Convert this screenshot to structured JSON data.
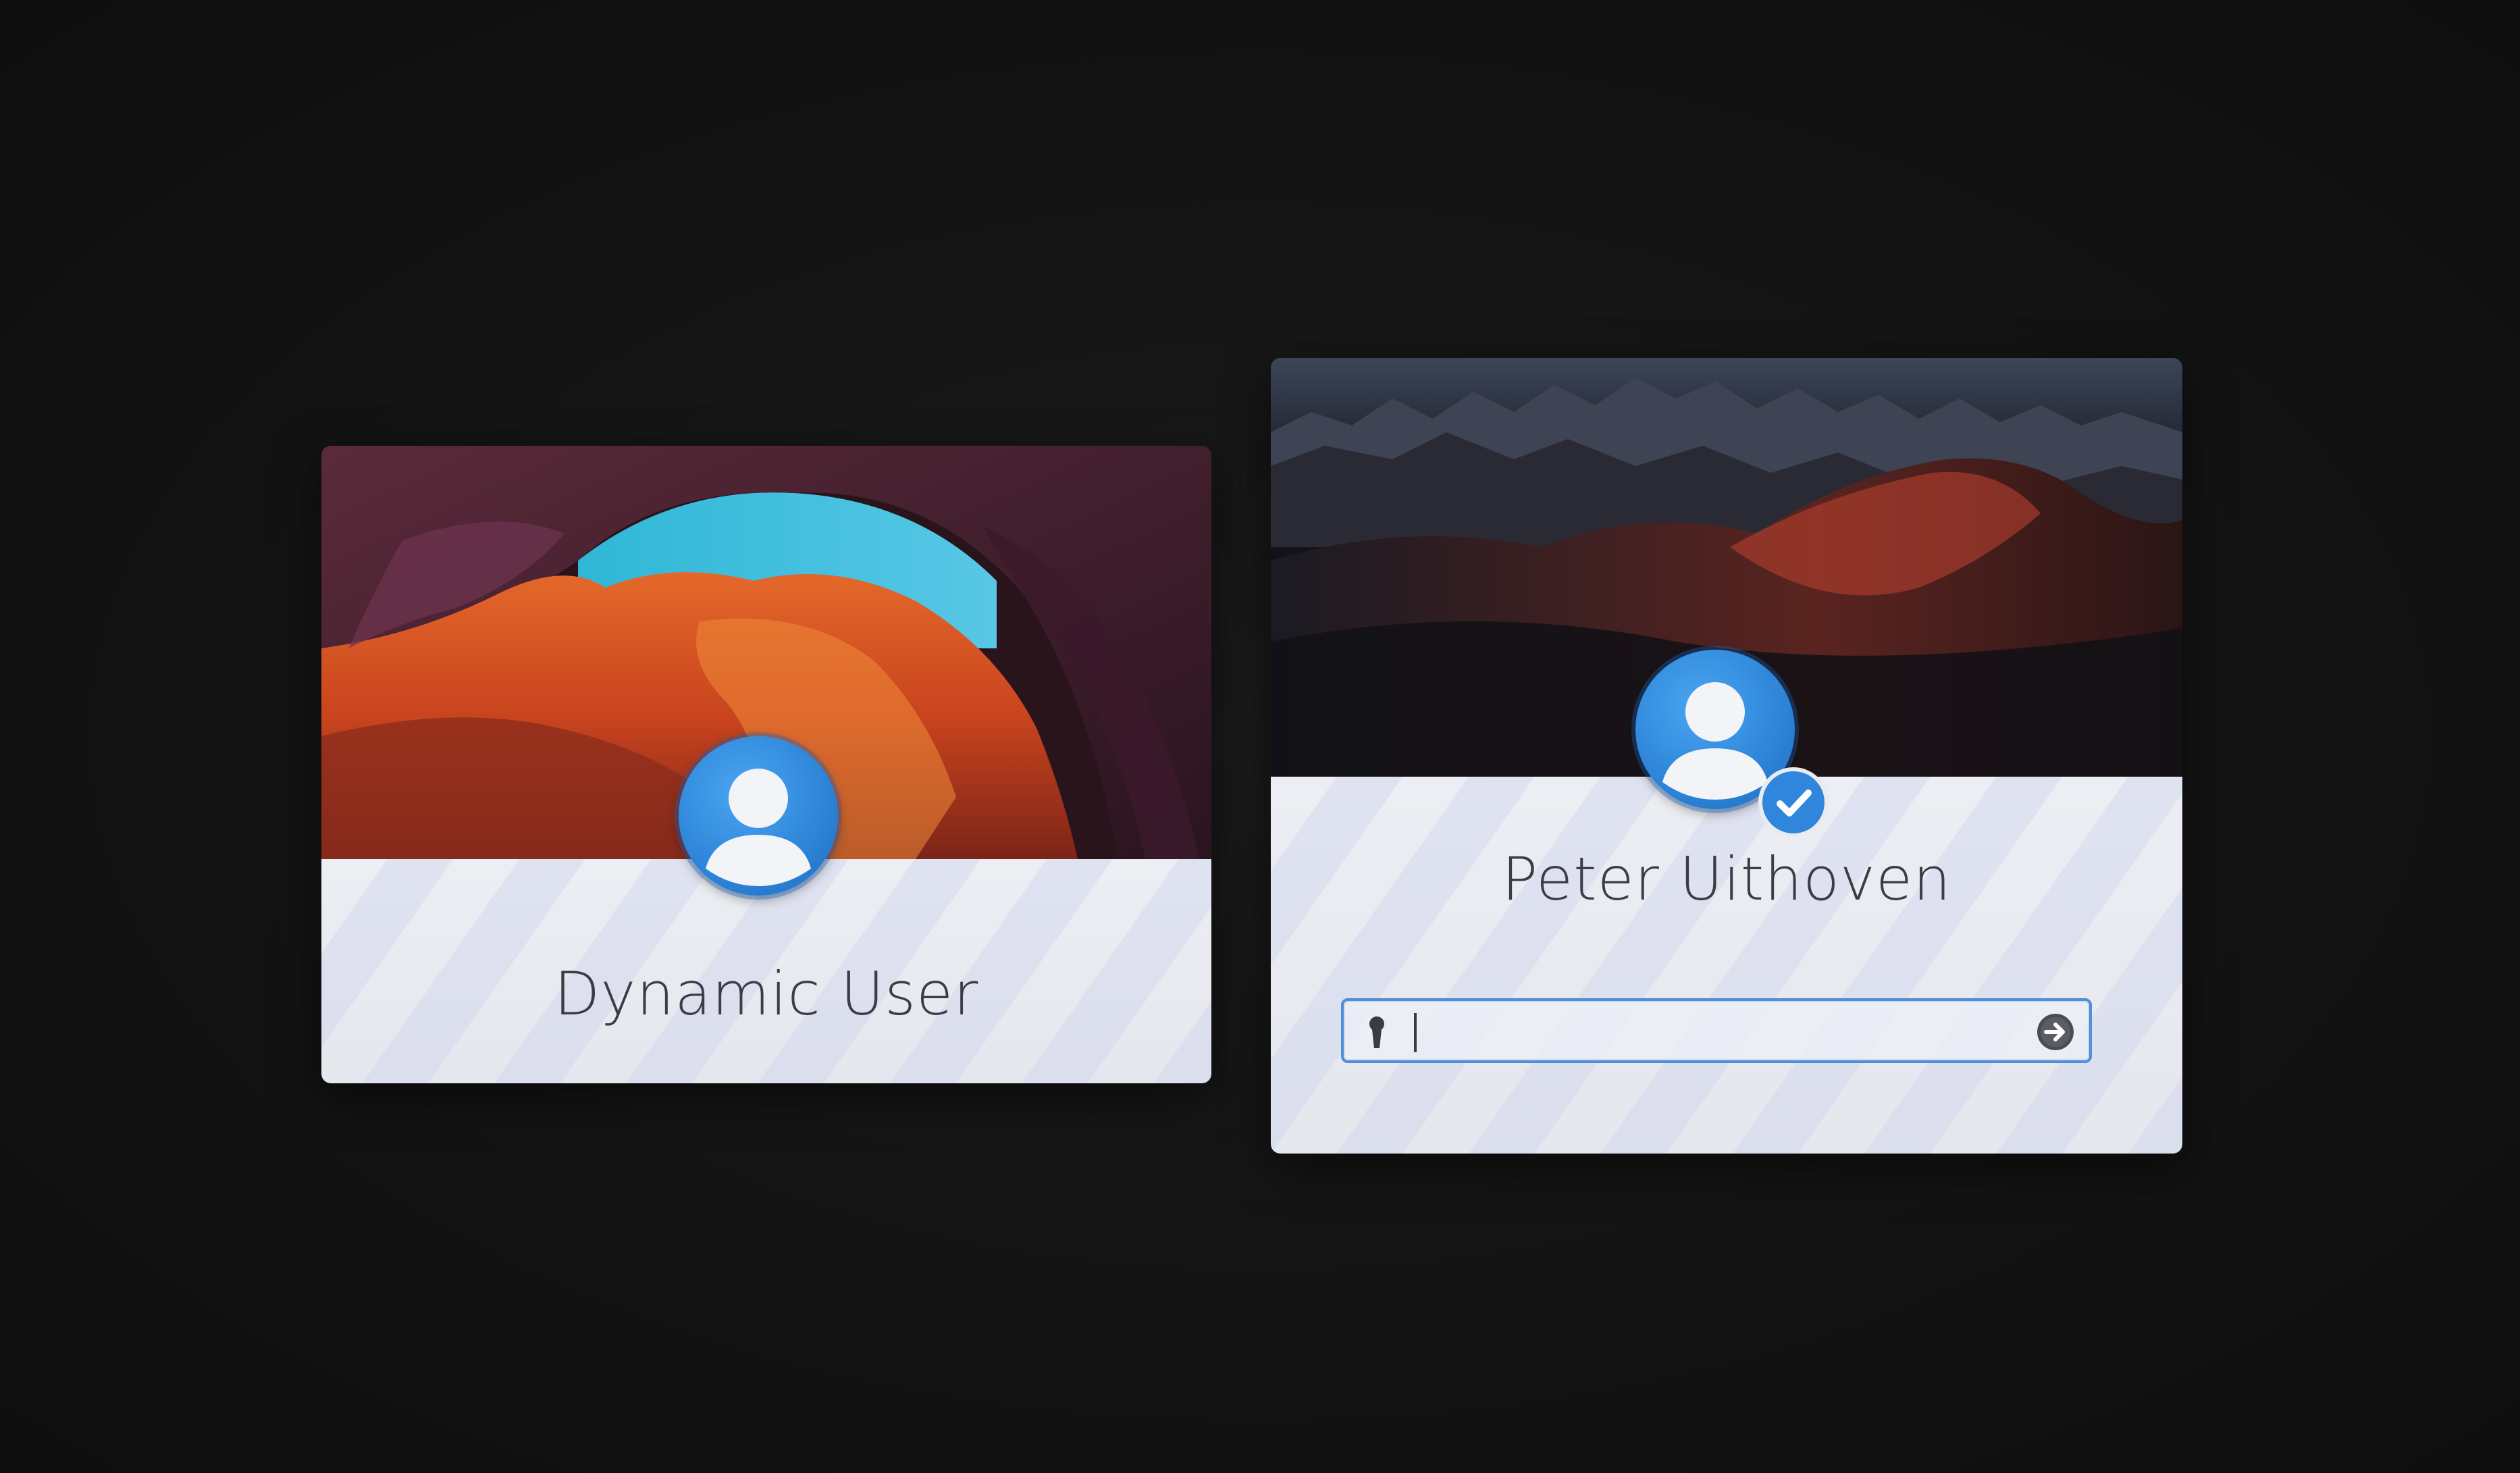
{
  "users": [
    {
      "id": "dynamic",
      "name": "Dynamic User",
      "avatar_icon": "user-avatar-icon",
      "banner_icon": "canyon-wallpaper"
    },
    {
      "id": "peter",
      "name": "Peter Uithoven",
      "avatar_icon": "user-avatar-icon",
      "banner_icon": "mountain-wallpaper",
      "selected_badge_icon": "check-icon",
      "password": {
        "value": "",
        "placeholder": "",
        "leading_icon": "key-icon",
        "submit_icon": "arrow-right-circle-icon"
      }
    }
  ],
  "colors": {
    "accent": "#2d84d8",
    "background": "#141414",
    "card_body": "#e7e9ef",
    "text": "#3b3d45"
  }
}
